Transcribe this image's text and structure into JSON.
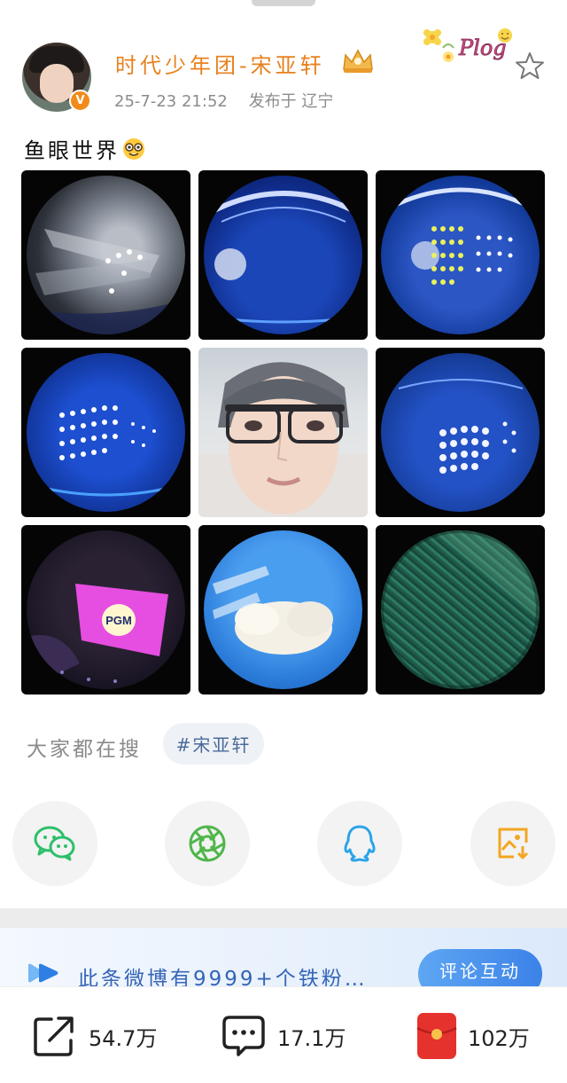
{
  "post": {
    "author_name": "时代少年团-宋亚轩",
    "timestamp": "25-7-23 21:52",
    "location": "发布于 辽宁",
    "text": "鱼眼世界",
    "plog_label": "Plog"
  },
  "photos": [
    {
      "icon": "fisheye-stage-smoke"
    },
    {
      "icon": "fisheye-blue-arena"
    },
    {
      "icon": "fisheye-yellow-light-wall"
    },
    {
      "icon": "fisheye-blue-light-wall"
    },
    {
      "icon": "selfie-portrait"
    },
    {
      "icon": "fisheye-light-grid"
    },
    {
      "icon": "fisheye-pgm-screen",
      "screen_text": "PGM"
    },
    {
      "icon": "fisheye-sky-cloud"
    },
    {
      "icon": "fisheye-grass"
    }
  ],
  "search": {
    "label": "大家都在搜",
    "tag": "#宋亚轩"
  },
  "share": [
    {
      "icon": "wechat-icon",
      "color": "#2dbf6a"
    },
    {
      "icon": "moments-icon",
      "color": "#4fb64a"
    },
    {
      "icon": "qq-icon",
      "color": "#2aa4e8"
    },
    {
      "icon": "save-image-icon",
      "color": "#f3a623"
    }
  ],
  "fans_banner": {
    "text": "此条微博有9999+个铁粉…",
    "button_label": "评论互动"
  },
  "actions": {
    "repost_count": "54.7万",
    "comment_count": "17.1万",
    "like_count": "102万"
  },
  "colors": {
    "author_name": "#e8811e",
    "link_blue": "#3565b8",
    "like_red": "#e5322d"
  }
}
